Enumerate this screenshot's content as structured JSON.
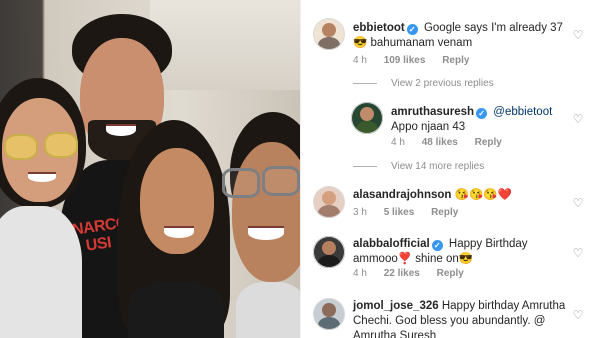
{
  "comments": [
    {
      "username": "ebbietoot",
      "verified": true,
      "text": "Google says I'm already 37😎 bahumanam venam",
      "time": "4 h",
      "likes": "109 likes",
      "reply": "Reply",
      "avatar_color": "#e7c9a6"
    },
    {
      "username": "amruthasuresh",
      "verified": true,
      "mention": "@ebbietoot",
      "text": "Appo njaan 43",
      "time": "4 h",
      "likes": "48 likes",
      "reply": "Reply",
      "avatar_color": "#1f3b2a"
    },
    {
      "username": "alasandrajohnson",
      "verified": false,
      "text": "😘😘😘❤️",
      "time": "3 h",
      "likes": "5 likes",
      "reply": "Reply",
      "avatar_color": "#d9b4a3"
    },
    {
      "username": "alabbalofficial",
      "verified": true,
      "text": "Happy Birthday ammooo❣️ shine on😎",
      "time": "4 h",
      "likes": "22 likes",
      "reply": "Reply",
      "avatar_color": "#2b2b2b"
    },
    {
      "username": "jomol_jose_326",
      "verified": false,
      "text": "Happy birthday Amrutha Chechi. God bless you abundantly. @ Amrutha Suresh",
      "avatar_color": "#6b7a86"
    }
  ],
  "view_replies": [
    "View 2 previous replies",
    "View 14 more replies"
  ],
  "icons": {
    "like": "heart-outline-icon",
    "verified": "verified-badge-icon"
  },
  "colors": {
    "verified_blue": "#3897f0",
    "mention_blue": "#00376b",
    "meta_gray": "#8e8e8e"
  },
  "photo": {
    "shirt_text_line1": "NARCO",
    "shirt_text_line2": "USI"
  }
}
